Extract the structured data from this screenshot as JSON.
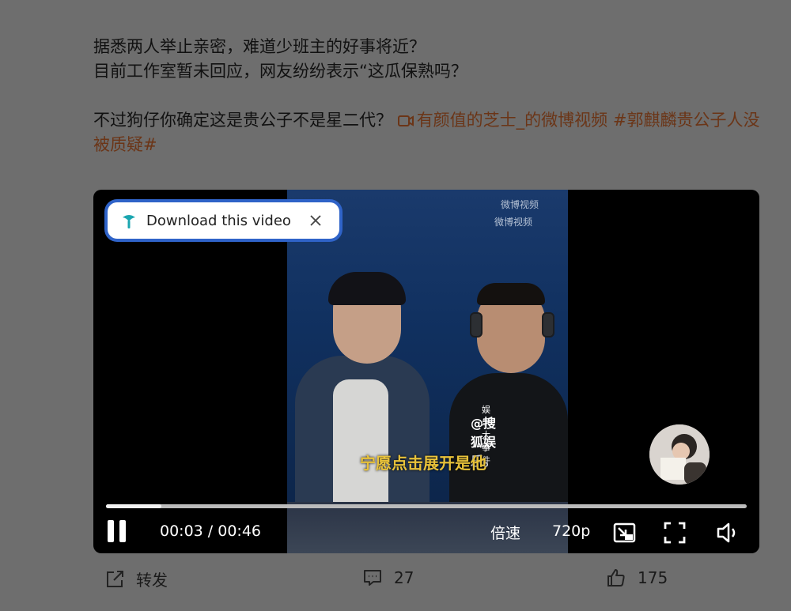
{
  "post": {
    "line1": "据悉两人举止亲密，难道少班主的好事将近？",
    "line2": "目前工作室暂未回应，网友纷纷表示“这瓜保熟吗？",
    "line3_prefix": "不过狗仔你确定这是贵公子不是星二代？",
    "video_link": "有颜值的芝士_的微博视频",
    "hashtag": "#郭麒麟贵公子人没被质疑#"
  },
  "video": {
    "download_label": "Download this video",
    "watermark_1": "微博视频",
    "watermark_2": "微博视频",
    "shirt_logo": "@搜狐娱乐。",
    "shirt_logo_top": "娱乐大事件",
    "caption": "宁愿点击展开是他",
    "progress_fraction": 0.086,
    "current_time": "00:03",
    "total_time": "00:46",
    "time_display": "00:03 / 00:46",
    "speed_label": "倍速",
    "quality_label": "720p"
  },
  "actions": {
    "repost_label": "转发",
    "comment_count": "27",
    "like_count": "175"
  }
}
